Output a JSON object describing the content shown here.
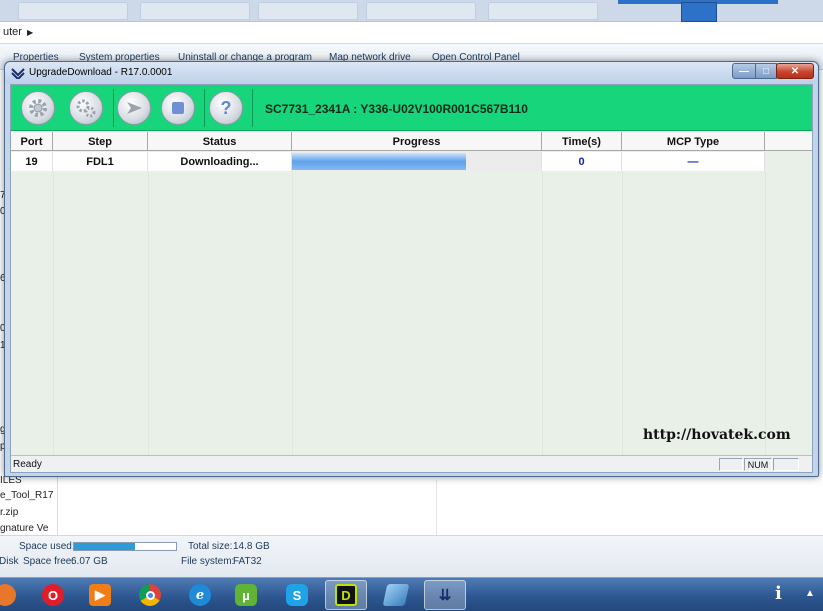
{
  "background_explorer": {
    "address_text": "uter",
    "toolbar_items": [
      "Properties",
      "System properties",
      "Uninstall or change a program",
      "Map network drive",
      "Open Control Panel"
    ],
    "left_pane_files": [
      "7",
      "0",
      "6",
      "0",
      "1",
      "g",
      "p",
      "ILES",
      "e_Tool_R17",
      "r.zip",
      "gnature Ve"
    ],
    "status": {
      "disk_label": "Disk",
      "space_used_label": "Space used:",
      "space_used_fraction": 0.6,
      "space_free_label": "Space free:",
      "space_free_value": "6.07 GB",
      "total_size_label": "Total size:",
      "total_size_value": "14.8 GB",
      "file_system_label": "File system:",
      "file_system_value": "FAT32"
    }
  },
  "window": {
    "title": "UpgradeDownload - R17.0.0001",
    "min_glyph": "—",
    "max_glyph": "□",
    "close_glyph": "✕"
  },
  "toolbar": {
    "buttons": [
      {
        "icon": "gear-icon"
      },
      {
        "icon": "gears-icon"
      },
      {
        "icon": "play-icon"
      },
      {
        "icon": "stop-icon"
      },
      {
        "icon": "help-icon",
        "glyph": "?"
      }
    ],
    "firmware_label": "SC7731_2341A : Y336-U02V100R001C567B110",
    "accent_color": "#17d57b"
  },
  "grid": {
    "columns": [
      "Port",
      "Step",
      "Status",
      "Progress",
      "Time(s)",
      "MCP Type"
    ],
    "rows": [
      {
        "port": "19",
        "step": "FDL1",
        "status": "Downloading...",
        "progress_fraction": 0.7,
        "time": "0",
        "mcp_type": "—"
      }
    ]
  },
  "watermark": "http://hovatek.com",
  "statusbar": {
    "text": "Ready",
    "num_indicator": "NUM"
  },
  "taskbar": {
    "apps": [
      "firefox-icon",
      "opera-icon",
      "media-player-icon",
      "chrome-icon",
      "ie-icon",
      "utorrent-icon",
      "skype-icon",
      "flash-tool-icon",
      "notepad-icon",
      "upgrade-download-icon"
    ],
    "tray_chevron": "▲",
    "tray_i": "i"
  }
}
